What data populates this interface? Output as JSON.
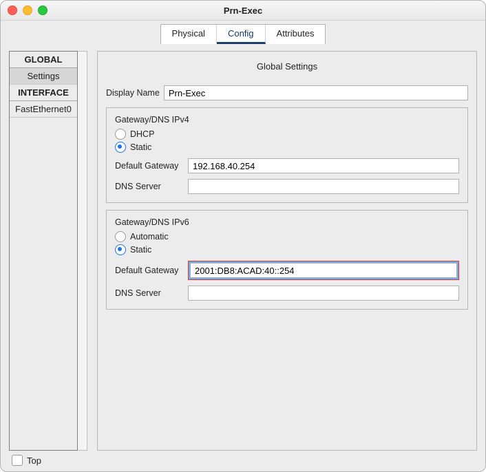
{
  "window": {
    "title": "Prn-Exec"
  },
  "tabs": {
    "items": [
      {
        "label": "Physical"
      },
      {
        "label": "Config"
      },
      {
        "label": "Attributes"
      }
    ],
    "active_index": 1
  },
  "sidebar": {
    "sections": [
      {
        "header": "GLOBAL",
        "items": [
          {
            "label": "Settings",
            "selected": true
          }
        ]
      },
      {
        "header": "INTERFACE",
        "items": [
          {
            "label": "FastEthernet0",
            "selected": false
          }
        ]
      }
    ]
  },
  "main": {
    "title": "Global Settings",
    "display_name": {
      "label": "Display Name",
      "value": "Prn-Exec"
    },
    "ipv4": {
      "title": "Gateway/DNS IPv4",
      "options": {
        "dhcp_label": "DHCP",
        "static_label": "Static",
        "selected": "static"
      },
      "default_gateway": {
        "label": "Default Gateway",
        "value": "192.168.40.254"
      },
      "dns_server": {
        "label": "DNS Server",
        "value": ""
      }
    },
    "ipv6": {
      "title": "Gateway/DNS IPv6",
      "options": {
        "auto_label": "Automatic",
        "static_label": "Static",
        "selected": "static"
      },
      "default_gateway": {
        "label": "Default Gateway",
        "value": "2001:DB8:ACAD:40::254"
      },
      "dns_server": {
        "label": "DNS Server",
        "value": ""
      }
    }
  },
  "footer": {
    "top_label": "Top",
    "top_checked": false
  }
}
